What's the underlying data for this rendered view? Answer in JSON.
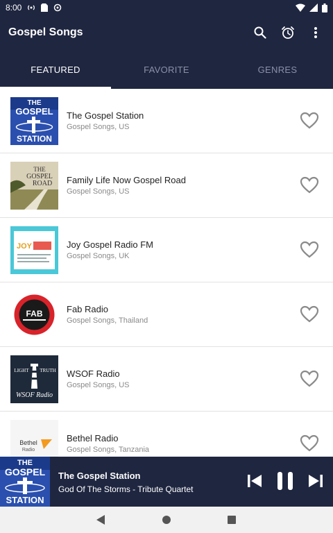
{
  "status_bar": {
    "time": "8:00"
  },
  "app": {
    "title": "Gospel Songs"
  },
  "tabs": [
    {
      "label": "FEATURED",
      "active": true
    },
    {
      "label": "FAVORITE",
      "active": false
    },
    {
      "label": "GENRES",
      "active": false
    }
  ],
  "stations": [
    {
      "name": "The Gospel Station",
      "subtitle": "Gospel Songs, US",
      "logo_text": [
        "THE",
        "GOSPEL",
        "STATION"
      ]
    },
    {
      "name": "Family Life Now Gospel Road",
      "subtitle": "Gospel Songs, US",
      "logo_text": [
        "THE",
        "GOSPEL",
        "ROAD"
      ]
    },
    {
      "name": "Joy Gospel Radio FM",
      "subtitle": "Gospel Songs, UK",
      "logo_text": [
        "JOY"
      ]
    },
    {
      "name": "Fab Radio",
      "subtitle": "Gospel Songs, Thailand",
      "logo_text": [
        "FAB"
      ]
    },
    {
      "name": "WSOF Radio",
      "subtitle": "Gospel Songs, US",
      "logo_text": [
        "LIGHT",
        "TRUTH",
        "WSOF Radio"
      ]
    },
    {
      "name": "Bethel Radio",
      "subtitle": "Gospel Songs, Tanzania",
      "logo_text": [
        "Bethel",
        "Radio"
      ]
    }
  ],
  "player": {
    "station": "The Gospel Station",
    "track": "God Of The Storms - Tribute Quartet",
    "logo_text": [
      "THE",
      "GOSPEL",
      "STATION"
    ]
  },
  "colors": {
    "bar": "#1f2640",
    "tab_inactive": "#8a90a6",
    "heart": "#8a8a8a"
  }
}
